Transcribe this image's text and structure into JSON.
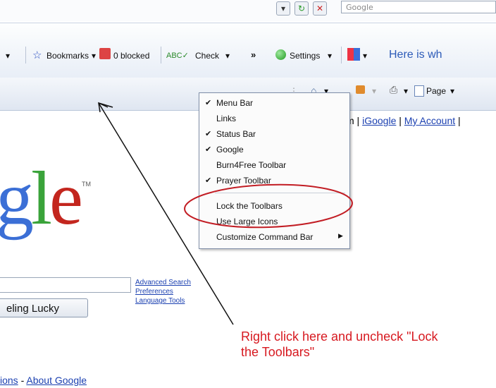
{
  "top": {
    "search_text": "Google"
  },
  "toolbar": {
    "bookmarks": "Bookmarks",
    "blocked": "0 blocked",
    "check": "Check",
    "more": "»",
    "settings": "Settings",
    "ticker": "Here is wh"
  },
  "command_bar": {
    "page": "Page"
  },
  "google_links": {
    "prefix": "m |",
    "igoogle": "iGoogle",
    "sep": "|",
    "my_account": "My Account",
    "suffix": "|"
  },
  "context_menu": {
    "items": [
      {
        "label": "Menu Bar",
        "checked": true
      },
      {
        "label": "Links",
        "checked": false
      },
      {
        "label": "Status Bar",
        "checked": true
      },
      {
        "label": "Google",
        "checked": true
      },
      {
        "label": "Burn4Free Toolbar",
        "checked": false
      },
      {
        "label": "Prayer Toolbar",
        "checked": true
      },
      {
        "label": "Lock the Toolbars",
        "checked": false
      },
      {
        "label": "Use Large Icons",
        "checked": false
      },
      {
        "label": "Customize Command Bar",
        "checked": false,
        "submenu": true
      }
    ]
  },
  "logo": {
    "text": "gle",
    "tm": "TM"
  },
  "search": {
    "advanced": "Advanced Search",
    "preferences": "Preferences",
    "language_tools": "Language Tools",
    "lucky_button": "eling Lucky"
  },
  "annotation": {
    "line1": "Right click here and uncheck \"Lock",
    "line2": "the Toolbars\""
  },
  "footer": {
    "ions": "ions",
    "dash": "-",
    "about": "About Google"
  },
  "colors": {
    "annotation_red": "#d71920",
    "link_blue": "#1a3fb0",
    "logo_blue": "#3b6fd6",
    "logo_red": "#c3261e",
    "logo_green": "#3aa33a"
  }
}
